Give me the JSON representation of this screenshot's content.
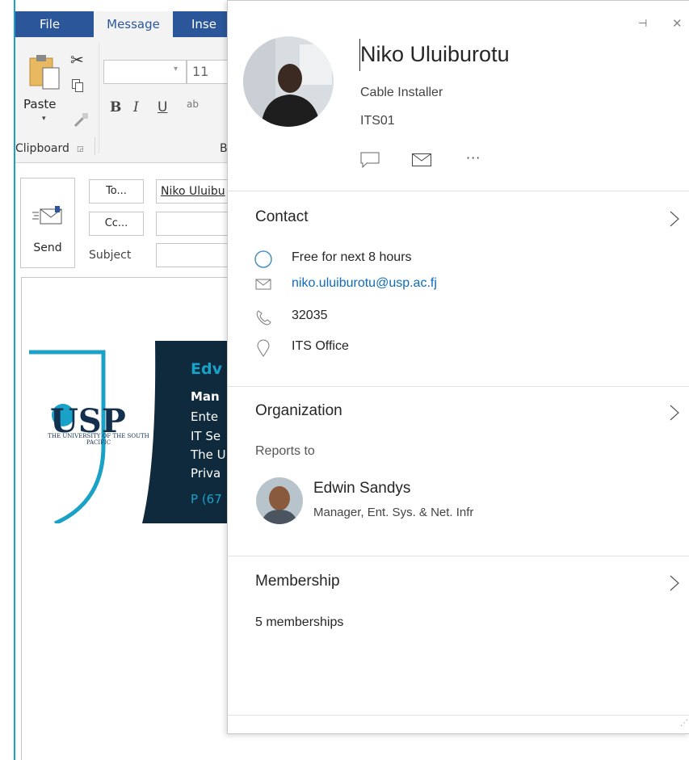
{
  "ribbon": {
    "tabs": [
      "File",
      "Message",
      "Inse"
    ],
    "paste_label": "Paste",
    "font_size": "11",
    "bold": "B",
    "italic": "I",
    "underline": "U",
    "strike": "ab",
    "clipboard_group": "Clipboard",
    "basic_text_group": "B"
  },
  "compose": {
    "send_label": "Send",
    "to_button": "To...",
    "cc_button": "Cc...",
    "subject_label": "Subject",
    "to_value": "Niko Uluibu"
  },
  "signature": {
    "logo_text": "USP",
    "logo_sub": "THE UNIVERSITY OF THE SOUTH PACIFIC",
    "lines": [
      "Edv",
      "Man",
      "Ente",
      "IT Se",
      "The U",
      "Priva",
      "P (67"
    ]
  },
  "card": {
    "name": "Niko Uluiburotu",
    "job_title": "Cable Installer",
    "department": "ITS01",
    "contact": {
      "title": "Contact",
      "availability": "Free for next 8 hours",
      "email": "niko.uluiburotu@usp.ac.fj",
      "phone": "32035",
      "office": "ITS Office"
    },
    "organization": {
      "title": "Organization",
      "reports_to_label": "Reports to",
      "manager_name": "Edwin Sandys",
      "manager_title": "Manager, Ent. Sys. & Net. Infr"
    },
    "membership": {
      "title": "Membership",
      "count_text": "5 memberships"
    }
  },
  "colors": {
    "ribbon_blue": "#2b579a",
    "accent_teal": "#19a1c8",
    "link_blue": "#0f6cbd",
    "sig_dark": "#0f2a3d"
  },
  "icons": [
    "cut-icon",
    "copy-icon",
    "format-painter-icon",
    "send-icon",
    "chat-icon",
    "mail-icon",
    "more-icon",
    "availability-icon",
    "envelope-icon",
    "phone-icon",
    "location-icon",
    "chevron-right-icon",
    "pin-icon",
    "close-icon"
  ]
}
